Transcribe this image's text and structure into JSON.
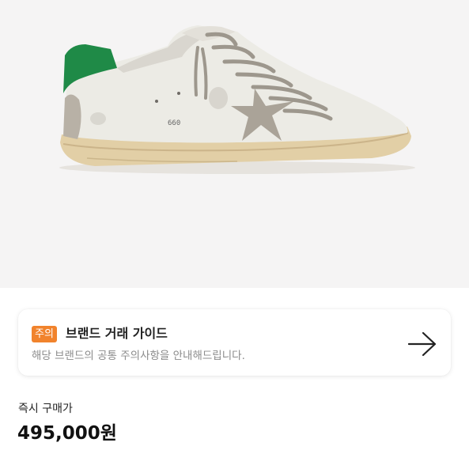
{
  "product": {
    "image_alt": "sneaker-product-photo"
  },
  "guide": {
    "badge": "주의",
    "title": "브랜드 거래 가이드",
    "description": "해당 브랜드의 공통 주의사항을 안내해드립니다.",
    "arrow_icon": "arrow-right-icon"
  },
  "price": {
    "label": "즉시 구매가",
    "value": "495,000원"
  },
  "colors": {
    "image_background": "#f5f4f4",
    "badge": "#f1832c",
    "heel_tab": "#1f8a47"
  }
}
